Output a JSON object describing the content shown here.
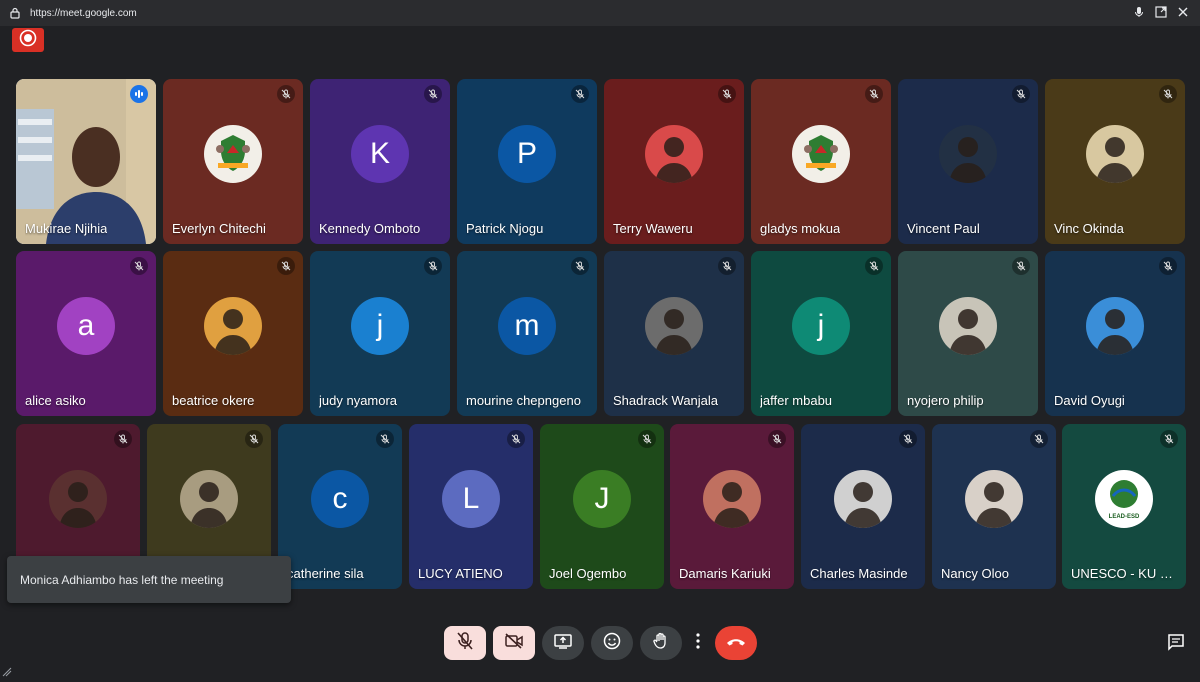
{
  "browser": {
    "url": "https://meet.google.com"
  },
  "tiles": [
    {
      "name": "Mukirae Njihia",
      "bg": "#c9b99a",
      "type": "video",
      "speaking": true
    },
    {
      "name": "Everlyn Chitechi",
      "bg": "#6b2a22",
      "type": "crest",
      "avatar_bg": "#f2efe8"
    },
    {
      "name": "Kennedy Omboto",
      "bg": "#3e2374",
      "type": "letter",
      "initial": "K",
      "avatar_bg": "#5e35b1"
    },
    {
      "name": "Patrick Njogu",
      "bg": "#0f3a5e",
      "type": "letter",
      "initial": "P",
      "avatar_bg": "#0b57a4"
    },
    {
      "name": "Terry Waweru",
      "bg": "#6a1d1d",
      "type": "photo",
      "avatar_bg": "#d94a4a"
    },
    {
      "name": "gladys mokua",
      "bg": "#6b2a22",
      "type": "crest",
      "avatar_bg": "#f2efe8"
    },
    {
      "name": "Vincent Paul",
      "bg": "#1c2b4a",
      "type": "photo",
      "avatar_bg": "#223044"
    },
    {
      "name": "Vinc Okinda",
      "bg": "#4a3a18",
      "type": "photo",
      "avatar_bg": "#d8c8a0"
    },
    {
      "name": "alice asiko",
      "bg": "#5a1a6a",
      "type": "letter",
      "initial": "a",
      "avatar_bg": "#a142c2"
    },
    {
      "name": "beatrice okere",
      "bg": "#5a2c12",
      "type": "photo",
      "avatar_bg": "#e0a040"
    },
    {
      "name": "judy nyamora",
      "bg": "#123a55",
      "type": "letter",
      "initial": "j",
      "avatar_bg": "#1a80d0"
    },
    {
      "name": "mourine chepngeno",
      "bg": "#123a55",
      "type": "letter",
      "initial": "m",
      "avatar_bg": "#0b57a4"
    },
    {
      "name": "Shadrack Wanjala",
      "bg": "#1e3048",
      "type": "photo",
      "avatar_bg": "#6c6c6c"
    },
    {
      "name": "jaffer mbabu",
      "bg": "#0e4a40",
      "type": "letter",
      "initial": "j",
      "avatar_bg": "#0e8a75"
    },
    {
      "name": "nyojero philip",
      "bg": "#2e4a48",
      "type": "photo",
      "avatar_bg": "#c8c4b8"
    },
    {
      "name": "David Oyugi",
      "bg": "#16324e",
      "type": "photo",
      "avatar_bg": "#3a8ed8"
    },
    {
      "name": "",
      "bg": "#4e1a2e",
      "type": "photo",
      "avatar_bg": "#5a3030"
    },
    {
      "name": "",
      "bg": "#3e3a1e",
      "type": "photo",
      "avatar_bg": "#a89c80"
    },
    {
      "name": "catherine sila",
      "bg": "#123a55",
      "type": "letter",
      "initial": "c",
      "avatar_bg": "#0b57a4"
    },
    {
      "name": "LUCY ATIENO",
      "bg": "#252e6a",
      "type": "letter",
      "initial": "L",
      "avatar_bg": "#5c6bc0"
    },
    {
      "name": "Joel Ogembo",
      "bg": "#1e4a1a",
      "type": "letter",
      "initial": "J",
      "avatar_bg": "#3a7d24"
    },
    {
      "name": "Damaris Kariuki",
      "bg": "#5a1a3a",
      "type": "photo",
      "avatar_bg": "#c07060"
    },
    {
      "name": "Charles Masinde",
      "bg": "#1c2b4a",
      "type": "photo",
      "avatar_bg": "#d0d0d0"
    },
    {
      "name": "Nancy Oloo",
      "bg": "#1e3250",
      "type": "photo",
      "avatar_bg": "#d8d0c8"
    },
    {
      "name": "UNESCO - KU LEAD-ESD",
      "bg": "#144a40",
      "type": "logo",
      "avatar_bg": "#ffffff",
      "logo_text": "LEAD-ESD"
    }
  ],
  "toast": {
    "message": "Monica Adhiambo has left the meeting"
  },
  "controls": {
    "mic": "mic-off-icon",
    "camera": "camera-off-icon",
    "present": "present-icon",
    "emoji": "emoji-icon",
    "hand": "raise-hand-icon",
    "more": "more-icon",
    "leave": "end-call-icon"
  },
  "colors": {
    "background": "#202124",
    "record": "#d93025",
    "muted_ctrl": "#f9dedc",
    "end_call": "#ea4335",
    "speaking": "#1a73e8"
  }
}
